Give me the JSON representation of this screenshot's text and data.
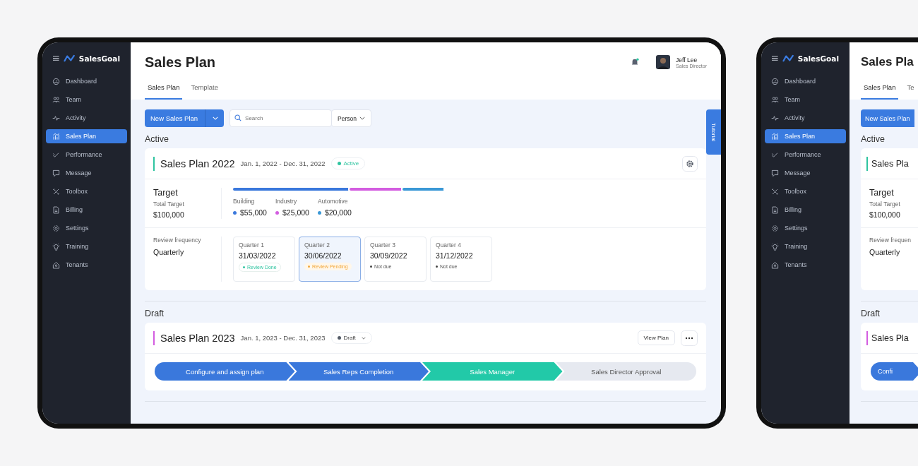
{
  "main_screen": {
    "sidebar": {
      "brand": "SalesGoal",
      "items": [
        {
          "label": "Dashboard",
          "kind": "gauge",
          "selected": false
        },
        {
          "label": "Team",
          "kind": "people",
          "selected": false
        },
        {
          "label": "Activity",
          "kind": "pulse",
          "selected": false
        },
        {
          "label": "Sales Plan",
          "kind": "chart",
          "selected": true
        },
        {
          "label": "Performance",
          "kind": "check",
          "selected": false
        },
        {
          "label": "Message",
          "kind": "bubble",
          "selected": false
        },
        {
          "label": "Toolbox",
          "kind": "tools",
          "selected": false
        },
        {
          "label": "Billing",
          "kind": "document",
          "selected": false
        },
        {
          "label": "Settings",
          "kind": "gear",
          "selected": false
        },
        {
          "label": "Training",
          "kind": "bulb",
          "selected": false
        },
        {
          "label": "Tenants",
          "kind": "house",
          "selected": false
        }
      ]
    },
    "header": {
      "title": "Sales Plan",
      "notification": true,
      "user": {
        "name": "Jeff Lee",
        "role": "Sales Director"
      }
    },
    "tabs": [
      {
        "label": "Sales Plan",
        "selected": true
      },
      {
        "label": "Template",
        "selected": false
      }
    ],
    "toolbar": {
      "new_button": "New Sales Plan",
      "search": {
        "placeholder": "Search"
      },
      "filter": "Person"
    },
    "tutorial": "Tutorial",
    "active": {
      "heading": "Active",
      "plan": {
        "title": "Sales Plan 2022",
        "dates": "Jan. 1, 2022 - Dec. 31, 2022",
        "status": "Active",
        "color": "#2ec4a0"
      },
      "target": {
        "label": "Target",
        "total_label": "Total Target",
        "total": "$100,000",
        "segments": [
          {
            "name": "Building",
            "amount": "$55,000",
            "color": "#3a78dc"
          },
          {
            "name": "Industry",
            "amount": "$25,000",
            "color": "#d35de0"
          },
          {
            "name": "Automotive",
            "amount": "$20,000",
            "color": "#3a98d6"
          }
        ]
      },
      "review": {
        "label": "Review frequency",
        "value": "Quarterly",
        "quarters": [
          {
            "name": "Quarter 1",
            "date": "31/03/2022",
            "status": "Review Done",
            "kind": "done",
            "selected": false
          },
          {
            "name": "Quarter 2",
            "date": "30/06/2022",
            "status": "Review Pending",
            "kind": "pending",
            "selected": true
          },
          {
            "name": "Quarter 3",
            "date": "30/09/2022",
            "status": "Not due",
            "kind": "none",
            "selected": false
          },
          {
            "name": "Quarter 4",
            "date": "31/12/2022",
            "status": "Not due",
            "kind": "none",
            "selected": false
          }
        ]
      }
    },
    "draft": {
      "heading": "Draft",
      "plan": {
        "title": "Sales Plan 2023",
        "dates": "Jan. 1, 2023 - Dec. 31, 2023",
        "status": "Draft",
        "color": "#d35de0"
      },
      "view_button": "View Plan",
      "steps": [
        {
          "label": "Configure and assign plan",
          "kind": "done"
        },
        {
          "label": "Sales Reps Completion",
          "kind": "done"
        },
        {
          "label": "Sales Manager",
          "kind": "current"
        },
        {
          "label": "Sales Director Approval",
          "kind": "pending"
        }
      ]
    }
  },
  "side_screen": {
    "sidebar": {
      "brand": "SalesGoal",
      "items": [
        {
          "label": "Dashboard",
          "kind": "gauge",
          "selected": false
        },
        {
          "label": "Team",
          "kind": "people",
          "selected": false
        },
        {
          "label": "Activity",
          "kind": "pulse",
          "selected": false
        },
        {
          "label": "Sales Plan",
          "kind": "chart",
          "selected": true
        },
        {
          "label": "Performance",
          "kind": "check",
          "selected": false
        },
        {
          "label": "Message",
          "kind": "bubble",
          "selected": false
        },
        {
          "label": "Toolbox",
          "kind": "tools",
          "selected": false
        },
        {
          "label": "Billing",
          "kind": "document",
          "selected": false
        },
        {
          "label": "Settings",
          "kind": "gear",
          "selected": false
        },
        {
          "label": "Training",
          "kind": "bulb",
          "selected": false
        },
        {
          "label": "Tenants",
          "kind": "house",
          "selected": false
        }
      ]
    },
    "title": "Sales Pla",
    "tabs": [
      {
        "label": "Sales Plan",
        "selected": true
      },
      {
        "label": "Te",
        "selected": false
      }
    ],
    "new_button": "New Sales Plan",
    "active": {
      "heading": "Active",
      "plan": {
        "title": "Sales Pla",
        "color": "#2ec4a0"
      },
      "target_label": "Target",
      "total_label": "Total Target",
      "total": "$100,000",
      "review_label": "Review frequen",
      "review_value": "Quarterly"
    },
    "draft": {
      "heading": "Draft",
      "plan": {
        "title": "Sales Pla",
        "color": "#d35de0"
      },
      "first_step": "Confi"
    }
  }
}
